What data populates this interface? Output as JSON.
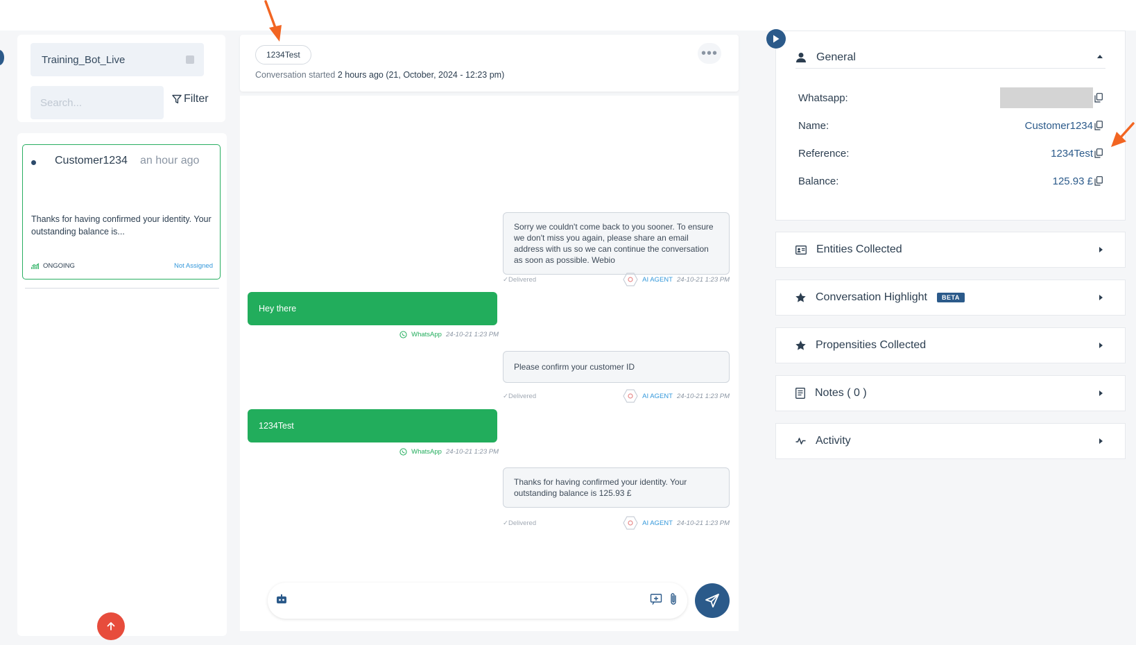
{
  "sidebar": {
    "bot_name": "Training_Bot_Live",
    "search_placeholder": "Search...",
    "filter_label": "Filter",
    "conversations": [
      {
        "name": "Customer1234",
        "time": "an hour ago",
        "preview": "Thanks for having confirmed your identity. Your outstanding balance is...",
        "status": "ONGOING",
        "assignee": "Not Assigned"
      }
    ]
  },
  "conversation": {
    "reference": "1234Test",
    "started_prefix": "Conversation started",
    "started_time": "2 hours ago (21, October, 2024 - 12:23 pm)",
    "more_label": "•••",
    "messages": [
      {
        "from": "ai",
        "text": "Sorry we couldn't come back to you sooner. To ensure we don't miss you again, please share an email address with us so we can continue the conversation as soon as possible. Webio",
        "status": "Delivered",
        "agent": "AI AGENT",
        "time": "24-10-21 1:23 PM"
      },
      {
        "from": "user",
        "text": "Hey there",
        "channel": "WhatsApp",
        "time": "24-10-21 1:23 PM"
      },
      {
        "from": "ai",
        "text": "Please confirm your customer ID",
        "status": "Delivered",
        "agent": "AI AGENT",
        "time": "24-10-21 1:23 PM"
      },
      {
        "from": "user",
        "text": "1234Test",
        "channel": "WhatsApp",
        "time": "24-10-21 1:23 PM"
      },
      {
        "from": "ai",
        "text": "Thanks for having confirmed your identity. Your outstanding balance is 125.93 £",
        "status": "Delivered",
        "agent": "AI AGENT",
        "time": "24-10-21 1:23 PM"
      }
    ],
    "composer_placeholder": ""
  },
  "details": {
    "general": {
      "title": "General",
      "fields": [
        {
          "label": "Whatsapp:",
          "value": ""
        },
        {
          "label": "Name:",
          "value": "Customer1234"
        },
        {
          "label": "Reference:",
          "value": "1234Test"
        },
        {
          "label": "Balance:",
          "value": "125.93 £"
        }
      ]
    },
    "sections": [
      {
        "title": "Entities Collected",
        "icon": "id-card-icon"
      },
      {
        "title": "Conversation Highlight",
        "icon": "star-icon",
        "badge": "BETA"
      },
      {
        "title": "Propensities Collected",
        "icon": "star-icon"
      },
      {
        "title": "Notes ( 0 )",
        "icon": "notes-icon"
      },
      {
        "title": "Activity",
        "icon": "activity-icon"
      }
    ]
  },
  "colors": {
    "primary": "#2b5a8a",
    "whatsapp_green": "#22ad5c",
    "link_blue": "#3498db",
    "annotation_orange": "#f26522",
    "scroll_up_red": "#e74c3c"
  }
}
